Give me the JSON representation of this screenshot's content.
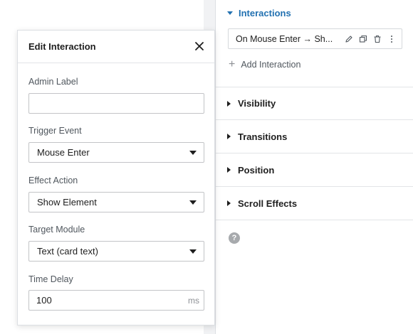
{
  "modal": {
    "title": "Edit Interaction",
    "fields": {
      "admin_label": {
        "label": "Admin Label",
        "value": ""
      },
      "trigger_event": {
        "label": "Trigger Event",
        "value": "Mouse Enter"
      },
      "effect_action": {
        "label": "Effect Action",
        "value": "Show Element"
      },
      "target_module": {
        "label": "Target Module",
        "value": "Text (card text)"
      },
      "time_delay": {
        "label": "Time Delay",
        "value": "100",
        "unit": "ms"
      }
    },
    "close_icon": "close-icon"
  },
  "settings": {
    "interactions": {
      "label": "Interactions",
      "items": [
        {
          "label": "On Mouse Enter → Sh..."
        }
      ],
      "add_label": "Add Interaction",
      "item_icons": [
        "edit-icon",
        "duplicate-icon",
        "trash-icon",
        "more-vertical-icon"
      ]
    },
    "sections": [
      {
        "label": "Visibility"
      },
      {
        "label": "Transitions"
      },
      {
        "label": "Position"
      },
      {
        "label": "Scroll Effects"
      }
    ],
    "help_icon": "?"
  },
  "colors": {
    "accent": "#2271b1",
    "canvas_bg": "#f1f2f4",
    "border": "#dcdfe3"
  }
}
